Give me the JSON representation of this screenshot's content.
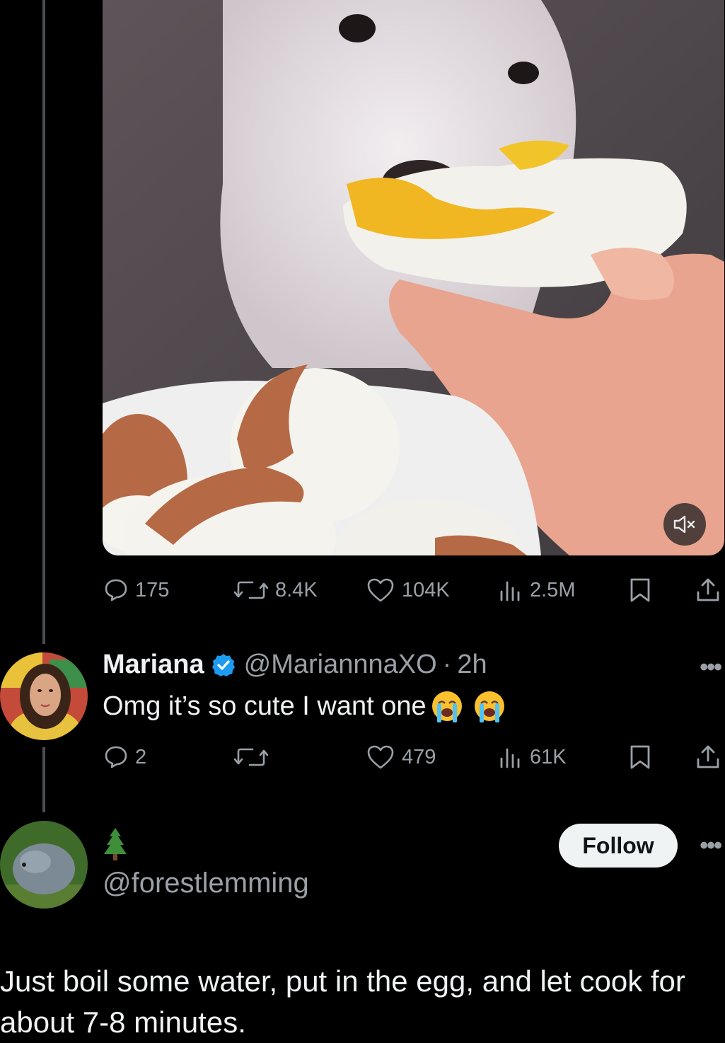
{
  "post": {
    "media": {
      "alt": "puppy eating a boiled egg",
      "mute_icon": "speaker-muted-icon"
    },
    "stats": {
      "replies": "175",
      "reposts": "8.4K",
      "likes": "104K",
      "views": "2.5M"
    }
  },
  "reply": {
    "name": "Mariana",
    "handle": "@MariannnaXO",
    "separator": "·",
    "time": "2h",
    "text": "Omg it’s so cute I want one",
    "stats": {
      "replies": "2",
      "reposts": "",
      "likes": "479",
      "views": "61K"
    },
    "more_label": "•••"
  },
  "user_card": {
    "emoji": "tree",
    "handle": "@forestlemming",
    "follow_label": "Follow",
    "more_label": "•••",
    "bio": "Just boil some water, put in the egg, and let cook for about 7-8 minutes."
  },
  "colors": {
    "verified": "#1d9bf0",
    "muted_text": "#9aa0a6",
    "thread_line": "#4a4e52"
  }
}
